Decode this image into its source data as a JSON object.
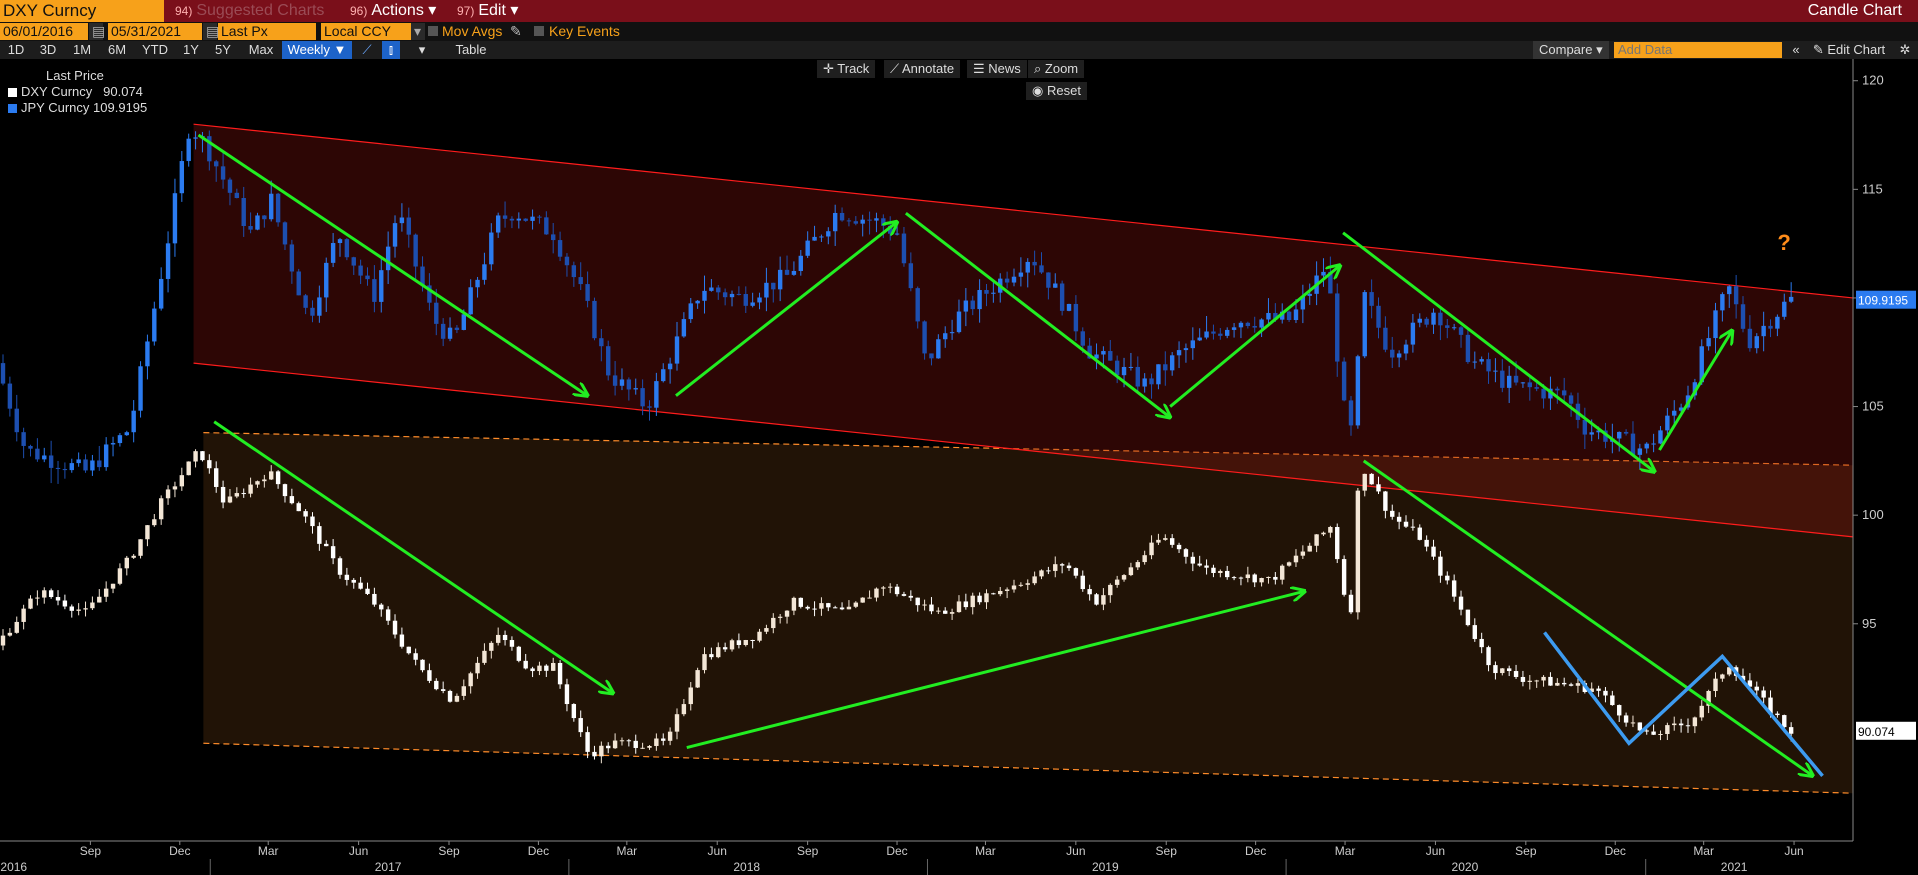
{
  "topbar": {
    "security": "DXY Curncy",
    "menu": [
      {
        "num": "94)",
        "label": "Suggested Charts",
        "dim": true
      },
      {
        "num": "96)",
        "label": "Actions ▾",
        "dim": false
      },
      {
        "num": "97)",
        "label": "Edit ▾",
        "dim": false
      }
    ],
    "title": "Candle Chart"
  },
  "controls": {
    "start_date": "06/01/2016",
    "end_date": "05/31/2021",
    "field": "Last Px",
    "currency": "Local CCY",
    "mov_avgs": "Mov Avgs",
    "key_events": "Key Events",
    "ranges": [
      "1D",
      "3D",
      "1M",
      "6M",
      "YTD",
      "1Y",
      "5Y",
      "Max"
    ],
    "frequency": "Weekly ▼",
    "table": "Table",
    "compare": "Compare ▾",
    "add_data_placeholder": "Add Data",
    "edit_chart": "Edit Chart"
  },
  "tools": {
    "track": "Track",
    "annotate": "Annotate",
    "news": "News",
    "zoom": "Zoom",
    "reset": "Reset"
  },
  "legend": {
    "title": "Last Price",
    "items": [
      {
        "name": "DXY Curncy",
        "value": "90.074",
        "color": "#ffffff"
      },
      {
        "name": "JPY Curncy",
        "value": "109.9195",
        "color": "#2b7bf0"
      }
    ]
  },
  "chart_data": {
    "type": "candlestick",
    "frequency": "weekly",
    "x_range": [
      "2016-06-01",
      "2021-07-31"
    ],
    "y_right": {
      "min": 85,
      "max": 121,
      "ticks": [
        95,
        100,
        105,
        110,
        115,
        120
      ]
    },
    "x_month_ticks": [
      "Sep",
      "Dec",
      "Mar",
      "Jun",
      "Sep",
      "Dec",
      "Mar",
      "Jun",
      "Sep",
      "Dec",
      "Mar",
      "Jun",
      "Sep",
      "Dec",
      "Mar",
      "Jun",
      "Sep",
      "Dec",
      "Mar",
      "Jun"
    ],
    "x_month_dates": [
      "2016-09-01",
      "2016-12-01",
      "2017-03-01",
      "2017-06-01",
      "2017-09-01",
      "2017-12-01",
      "2018-03-01",
      "2018-06-01",
      "2018-09-01",
      "2018-12-01",
      "2019-03-01",
      "2019-06-01",
      "2019-09-01",
      "2019-12-01",
      "2020-03-01",
      "2020-06-01",
      "2020-09-01",
      "2020-12-01",
      "2021-03-01",
      "2021-06-01"
    ],
    "x_years": [
      "2016",
      "2017",
      "2018",
      "2019",
      "2020",
      "2021"
    ],
    "x_year_dates": [
      "2016-06-15",
      "2017-07-01",
      "2018-07-01",
      "2019-07-01",
      "2020-07-01",
      "2021-04-01"
    ],
    "series": [
      {
        "name": "JPY Curncy",
        "color": "#2b7bf0",
        "last": 109.9195,
        "anchors": [
          [
            "2016-06-01",
            107
          ],
          [
            "2016-07-01",
            103
          ],
          [
            "2016-09-01",
            102
          ],
          [
            "2016-10-15",
            104
          ],
          [
            "2016-11-20",
            112
          ],
          [
            "2016-12-15",
            118
          ],
          [
            "2017-01-01",
            117
          ],
          [
            "2017-02-15",
            113
          ],
          [
            "2017-03-08",
            114.5
          ],
          [
            "2017-04-15",
            109
          ],
          [
            "2017-05-15",
            113
          ],
          [
            "2017-06-20",
            110
          ],
          [
            "2017-07-15",
            114
          ],
          [
            "2017-08-20",
            109
          ],
          [
            "2017-09-10",
            108
          ],
          [
            "2017-10-25",
            113.5
          ],
          [
            "2017-11-10",
            114
          ],
          [
            "2017-12-20",
            113
          ],
          [
            "2018-01-20",
            110
          ],
          [
            "2018-02-15",
            106.5
          ],
          [
            "2018-03-25",
            105
          ],
          [
            "2018-04-15",
            107
          ],
          [
            "2018-05-20",
            110.5
          ],
          [
            "2018-06-30",
            110
          ],
          [
            "2018-08-15",
            111
          ],
          [
            "2018-10-05",
            114
          ],
          [
            "2018-11-15",
            113.5
          ],
          [
            "2018-12-05",
            113
          ],
          [
            "2018-12-20",
            110
          ],
          [
            "2019-01-03",
            107
          ],
          [
            "2019-02-01",
            109
          ],
          [
            "2019-04-20",
            112
          ],
          [
            "2019-05-20",
            110
          ],
          [
            "2019-06-20",
            107.5
          ],
          [
            "2019-08-15",
            106
          ],
          [
            "2019-09-20",
            107.5
          ],
          [
            "2019-11-15",
            109
          ],
          [
            "2020-01-10",
            109
          ],
          [
            "2020-02-15",
            111.5
          ],
          [
            "2020-03-09",
            103
          ],
          [
            "2020-03-25",
            110
          ],
          [
            "2020-04-20",
            107.5
          ],
          [
            "2020-06-05",
            109.5
          ],
          [
            "2020-07-15",
            107
          ],
          [
            "2020-08-20",
            106
          ],
          [
            "2020-10-15",
            105.5
          ],
          [
            "2020-11-05",
            104
          ],
          [
            "2021-01-05",
            103
          ],
          [
            "2021-02-15",
            105.5
          ],
          [
            "2021-03-30",
            110.5
          ],
          [
            "2021-04-20",
            108
          ],
          [
            "2021-05-31",
            109.9195
          ]
        ]
      },
      {
        "name": "DXY Curncy",
        "color": "#ffffff",
        "last": 90.074,
        "anchors": [
          [
            "2016-06-01",
            94
          ],
          [
            "2016-07-15",
            96.5
          ],
          [
            "2016-09-01",
            95.5
          ],
          [
            "2016-10-15",
            98
          ],
          [
            "2016-11-15",
            100.5
          ],
          [
            "2016-12-25",
            103
          ],
          [
            "2017-01-20",
            100.5
          ],
          [
            "2017-03-05",
            102
          ],
          [
            "2017-04-10",
            100
          ],
          [
            "2017-05-15",
            97.5
          ],
          [
            "2017-06-20",
            96
          ],
          [
            "2017-08-05",
            93
          ],
          [
            "2017-09-08",
            91.5
          ],
          [
            "2017-10-25",
            94.5
          ],
          [
            "2017-11-25",
            93
          ],
          [
            "2017-12-20",
            93
          ],
          [
            "2018-01-25",
            89
          ],
          [
            "2018-02-20",
            89.5
          ],
          [
            "2018-04-15",
            89.5
          ],
          [
            "2018-05-20",
            93.5
          ],
          [
            "2018-07-15",
            94.5
          ],
          [
            "2018-08-20",
            96
          ],
          [
            "2018-10-15",
            95.5
          ],
          [
            "2018-11-20",
            96.8
          ],
          [
            "2019-01-15",
            95.5
          ],
          [
            "2019-04-15",
            97
          ],
          [
            "2019-05-25",
            97.8
          ],
          [
            "2019-06-25",
            96
          ],
          [
            "2019-09-01",
            99
          ],
          [
            "2019-10-15",
            97.5
          ],
          [
            "2019-12-20",
            97
          ],
          [
            "2020-02-20",
            99.5
          ],
          [
            "2020-03-10",
            95
          ],
          [
            "2020-03-20",
            102.5
          ],
          [
            "2020-04-20",
            100
          ],
          [
            "2020-05-20",
            99
          ],
          [
            "2020-06-15",
            97
          ],
          [
            "2020-08-01",
            93
          ],
          [
            "2020-09-01",
            92.5
          ],
          [
            "2020-11-15",
            92
          ],
          [
            "2021-01-05",
            89.8
          ],
          [
            "2021-02-20",
            90.5
          ],
          [
            "2021-03-30",
            93.2
          ],
          [
            "2021-05-31",
            90.074
          ]
        ]
      }
    ],
    "overlays": {
      "jpy_channel": {
        "color": "#ff1c1c",
        "upper": [
          [
            "2016-12-15",
            118
          ],
          [
            "2021-07-31",
            110
          ]
        ],
        "lower": [
          [
            "2016-12-15",
            107
          ],
          [
            "2021-07-31",
            99
          ]
        ]
      },
      "dxy_channel": {
        "color": "#ff8c2a",
        "upper": [
          [
            "2016-12-25",
            103.8
          ],
          [
            "2021-07-31",
            102.3
          ]
        ],
        "lower": [
          [
            "2016-12-25",
            89.5
          ],
          [
            "2021-07-31",
            87.2
          ]
        ]
      },
      "green_arrows": [
        [
          [
            "2016-12-20",
            117.5
          ],
          [
            "2018-01-20",
            105.5
          ]
        ],
        [
          [
            "2018-04-20",
            105.5
          ],
          [
            "2018-12-01",
            113.5
          ]
        ],
        [
          [
            "2018-12-10",
            113.9
          ],
          [
            "2019-09-05",
            104.5
          ]
        ],
        [
          [
            "2019-09-05",
            105
          ],
          [
            "2020-02-25",
            111.5
          ]
        ],
        [
          [
            "2020-02-28",
            113
          ],
          [
            "2021-01-10",
            102
          ]
        ],
        [
          [
            "2021-01-15",
            103
          ],
          [
            "2021-03-30",
            108.5
          ]
        ],
        [
          [
            "2017-01-05",
            104.3
          ],
          [
            "2018-02-15",
            91.8
          ]
        ],
        [
          [
            "2018-05-01",
            89.3
          ],
          [
            "2020-01-20",
            96.5
          ]
        ],
        [
          [
            "2020-03-20",
            102.5
          ],
          [
            "2021-06-20",
            88
          ]
        ]
      ],
      "blue_lines": [
        [
          [
            "2020-09-20",
            94.6
          ],
          [
            "2020-12-15",
            89.5
          ],
          [
            "2021-03-20",
            93.5
          ],
          [
            "2021-06-30",
            88
          ]
        ]
      ],
      "question_mark": {
        "text": "?",
        "date": "2021-05-15",
        "value": 112.2,
        "color": "#ff8c1a"
      }
    }
  }
}
